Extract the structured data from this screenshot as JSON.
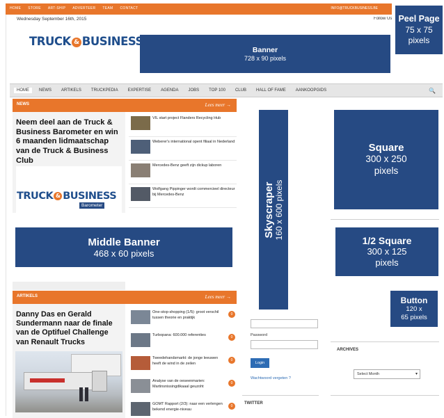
{
  "topbar": {
    "links": [
      "HOME",
      "STORE",
      "ART-SHIP",
      "ADVERTEER",
      "TEAM",
      "CONTACT"
    ],
    "email": "INFO@TRUCKBUSINESS.BE"
  },
  "date": "Wednesday September 16th, 2015",
  "follow": "Follow Us",
  "logo": {
    "left": "TRUCK",
    "amp": "&",
    "right": "BUSINESS"
  },
  "ads": {
    "peel": {
      "title": "Peel Page",
      "size": "75 x 75",
      "unit": "pixels"
    },
    "banner": {
      "title": "Banner",
      "size": "728 x 90 pixels"
    },
    "middle": {
      "title": "Middle Banner",
      "size": "468 x 60 pixels"
    },
    "sky": {
      "title": "Skyscraper",
      "size": "160 x 600 pixels"
    },
    "square": {
      "title": "Square",
      "size": "300 x 250",
      "unit": "pixels"
    },
    "half": {
      "title": "1/2 Square",
      "size": "300 x 125",
      "unit": "pixels"
    },
    "button": {
      "title": "Button",
      "size": "120 x",
      "unit": "65 pixels"
    }
  },
  "nav": {
    "items": [
      "HOME",
      "NEWS",
      "ARTIKELS",
      "TRUCKPEDIA",
      "EXPERTISE",
      "AGENDA",
      "JOBS",
      "TOP 100",
      "CLUB",
      "HALL OF FAME",
      "AANKOOPGIDS"
    ],
    "search_icon": "🔍"
  },
  "news": {
    "label": "NEWS",
    "more": "Lees meer →",
    "headline": "Neem deel aan de Truck & Business Barometer en win 6 maanden lidmaatschap van de Truck & Business Club",
    "barometer": "Barometer",
    "items": [
      "VIL start project Flanders Recycling Hub",
      "Weberer's international opent filiaal in Nederland",
      "Mercedes-Benz geeft zijn dickup laboren",
      "Wolfgang Pippinger wordt commercieel directeur bij Mercedes-Benz"
    ]
  },
  "articles": {
    "label": "ARTIKELS",
    "more": "Lees meer →",
    "headline": "Danny Das en Gerald Sundermann naar de finale van de Optifuel Challenge van Renault Trucks",
    "items": [
      {
        "text": "One-stop-shopping (1/5): groot verschil tussen theorie en praktijk",
        "count": "0"
      },
      {
        "text": "Turbopana: 600.000 referenties",
        "count": "0"
      },
      {
        "text": "Tweedehandsmarkt: de jonge leeuwen heeft de wind in de zeilen",
        "count": "0"
      },
      {
        "text": "Analyse van de oeseenmarien: Martinsnissingdikaaal geuzoht",
        "count": "0"
      },
      {
        "text": "GOMT Rapport (2/3): naar een verlengen bekend energie-niveau",
        "count": "0"
      }
    ]
  },
  "login": {
    "password_label": "Password",
    "login_button": "Login",
    "forgot": "Wachtwoord vergeten ?"
  },
  "twitter": "TWITTER",
  "archives": {
    "title": "ARCHIVES",
    "select": "Select Month"
  }
}
